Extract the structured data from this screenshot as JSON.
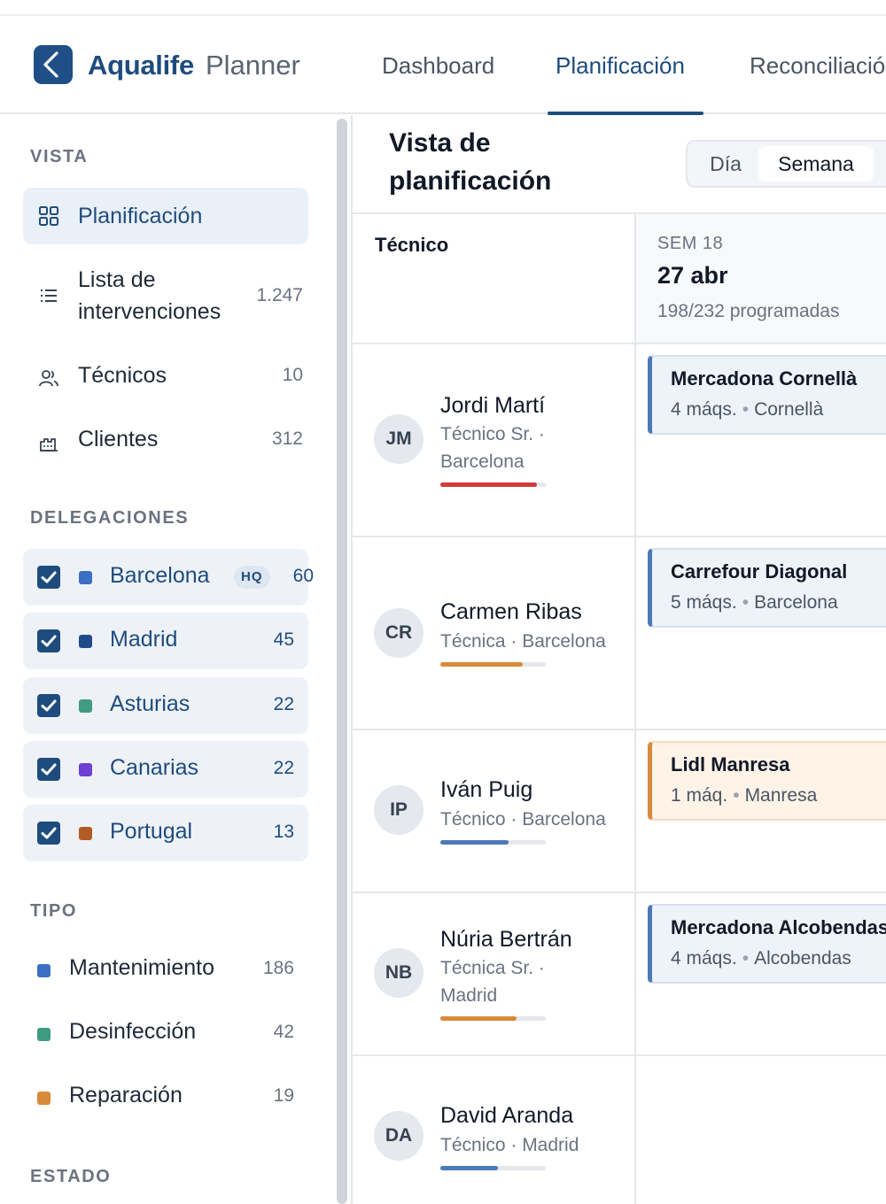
{
  "header": {
    "brand": "Aqualife",
    "brand_sub": "Planner",
    "tabs": [
      {
        "label": "Dashboard",
        "active": false
      },
      {
        "label": "Planificación",
        "active": true
      },
      {
        "label": "Reconciliación",
        "active": false
      }
    ]
  },
  "sidebar": {
    "vista_title": "VISTA",
    "vista_items": [
      {
        "label": "Planificación",
        "icon": "grid-icon",
        "count": ""
      },
      {
        "label": "Lista de intervenciones",
        "icon": "list-icon",
        "count": "1.247"
      },
      {
        "label": "Técnicos",
        "icon": "users-icon",
        "count": "10"
      },
      {
        "label": "Clientes",
        "icon": "building-icon",
        "count": "312"
      }
    ],
    "delegaciones_title": "DELEGACIONES",
    "delegaciones": [
      {
        "label": "Barcelona",
        "badge": "HQ",
        "count": "60",
        "color": "#3b6fc4",
        "checked": true
      },
      {
        "label": "Madrid",
        "badge": "",
        "count": "45",
        "color": "#1e4c8a",
        "checked": true
      },
      {
        "label": "Asturias",
        "badge": "",
        "count": "22",
        "color": "#3f9b83",
        "checked": true
      },
      {
        "label": "Canarias",
        "badge": "",
        "count": "22",
        "color": "#6d3fd6",
        "checked": true
      },
      {
        "label": "Portugal",
        "badge": "",
        "count": "13",
        "color": "#b45a24",
        "checked": true
      }
    ],
    "tipo_title": "TIPO",
    "tipos": [
      {
        "label": "Mantenimiento",
        "count": "186",
        "color": "#3b6fc4"
      },
      {
        "label": "Desinfección",
        "count": "42",
        "color": "#3f9b83"
      },
      {
        "label": "Reparación",
        "count": "19",
        "color": "#d98a3a"
      }
    ],
    "estado_title": "ESTADO"
  },
  "main": {
    "title": "Vista de planificación",
    "view_toggle": {
      "options": [
        "Día",
        "Semana"
      ],
      "selected": "Semana"
    },
    "column_tecnico": "Técnico",
    "week": {
      "label": "SEM 18",
      "date": "27 abr",
      "programadas": "198/232 programadas"
    },
    "technicians": [
      {
        "initials": "JM",
        "name": "Jordi Martí",
        "role": "Técnico Sr. · Barcelona",
        "load": 0.92,
        "load_color": "#d23b3b",
        "card": {
          "title": "Mercadona Cornellà",
          "maq": "4 máqs.",
          "place": "Cornellà",
          "kind": "blue"
        }
      },
      {
        "initials": "CR",
        "name": "Carmen Ribas",
        "role": "Técnica · Barcelona",
        "load": 0.78,
        "load_color": "#d98a3a",
        "card": {
          "title": "Carrefour Diagonal",
          "maq": "5 máqs.",
          "place": "Barcelona",
          "kind": "blue"
        }
      },
      {
        "initials": "IP",
        "name": "Iván Puig",
        "role": "Técnico · Barcelona",
        "load": 0.65,
        "load_color": "#4a7ab8",
        "card": {
          "title": "Lidl Manresa",
          "maq": "1 máq.",
          "place": "Manresa",
          "kind": "orange"
        }
      },
      {
        "initials": "NB",
        "name": "Núria Bertrán",
        "role": "Técnica Sr. · Madrid",
        "load": 0.72,
        "load_color": "#d98a3a",
        "card": {
          "title": "Mercadona Alcobendas",
          "maq": "4 máqs.",
          "place": "Alcobendas",
          "kind": "blue"
        }
      },
      {
        "initials": "DA",
        "name": "David Aranda",
        "role": "Técnico · Madrid",
        "load": 0.55,
        "load_color": "#4a7ab8",
        "card": null
      }
    ]
  }
}
